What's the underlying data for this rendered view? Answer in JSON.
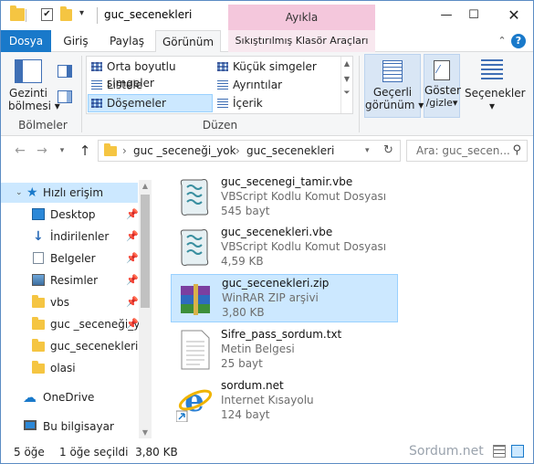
{
  "window": {
    "title": "guc_secenekleri",
    "context_tab": "Ayıkla",
    "accent": "#1979ca",
    "selection_color": "#cce8ff"
  },
  "quick_access_icons": [
    "folder-icon",
    "checkmark-icon",
    "folder-icon",
    "dropdown-arrow-icon"
  ],
  "ribbon": {
    "tabs": [
      {
        "label": "Dosya"
      },
      {
        "label": "Giriş"
      },
      {
        "label": "Paylaş"
      },
      {
        "label": "Görünüm"
      },
      {
        "label": "Sıkıştırılmış Klasör Araçları"
      }
    ],
    "panes": {
      "nav_pane_line1": "Gezinti",
      "nav_pane_line2": "bölmesi",
      "group_label": "Bölmeler"
    },
    "layout": {
      "items": [
        {
          "label": "Orta boyutlu simgeler"
        },
        {
          "label": "Küçük simgeler"
        },
        {
          "label": "Listele"
        },
        {
          "label": "Ayrıntılar"
        },
        {
          "label": "Döşemeler"
        },
        {
          "label": "İçerik"
        }
      ],
      "selected": "Döşemeler",
      "group_label": "Düzen"
    },
    "current_view": {
      "line1": "Geçerli",
      "line2": "görünüm"
    },
    "show_hide": {
      "line1": "Göster",
      "line2": "/gizle"
    },
    "options": {
      "label": "Seçenekler"
    }
  },
  "address": {
    "crumbs": [
      "guc _seceneği_yok",
      "guc_secenekleri"
    ],
    "search_placeholder": "Ara: guc_secen..."
  },
  "nav_pane": {
    "items": [
      {
        "label": "Hızlı erişim",
        "icon": "star-icon",
        "pinned": false
      },
      {
        "label": "Desktop",
        "icon": "desktop-icon",
        "pinned": true
      },
      {
        "label": "İndirilenler",
        "icon": "download-icon",
        "pinned": true
      },
      {
        "label": "Belgeler",
        "icon": "documents-icon",
        "pinned": true
      },
      {
        "label": "Resimler",
        "icon": "pictures-icon",
        "pinned": true
      },
      {
        "label": "vbs",
        "icon": "folder-icon",
        "pinned": true
      },
      {
        "label": "guc _seceneği_y",
        "icon": "folder-icon",
        "pinned": true
      },
      {
        "label": "guc_secenekleri",
        "icon": "folder-icon",
        "pinned": false
      },
      {
        "label": "olasi",
        "icon": "folder-icon",
        "pinned": false
      },
      {
        "label": "OneDrive",
        "icon": "cloud-icon",
        "pinned": false
      },
      {
        "label": "Bu bilgisayar",
        "icon": "computer-icon",
        "pinned": false
      }
    ]
  },
  "files": [
    {
      "name": "guc_secenegi_tamir.vbe",
      "type": "VBScript Kodlu Komut Dosyası",
      "size": "545 bayt",
      "icon": "vbscript-icon",
      "selected": false
    },
    {
      "name": "guc_secenekleri.vbe",
      "type": "VBScript Kodlu Komut Dosyası",
      "size": "4,59 KB",
      "icon": "vbscript-icon",
      "selected": false
    },
    {
      "name": "guc_secenekleri.zip",
      "type": "WinRAR ZIP arşivi",
      "size": "3,80 KB",
      "icon": "winrar-icon",
      "selected": true
    },
    {
      "name": "Sifre_pass_sordum.txt",
      "type": "Metin Belgesi",
      "size": "25 bayt",
      "icon": "text-document-icon",
      "selected": false
    },
    {
      "name": "sordum.net",
      "type": "Internet Kısayolu",
      "size": "124 bayt",
      "icon": "internet-explorer-icon",
      "selected": false
    }
  ],
  "status": {
    "count": "5 öğe",
    "selection": "1 öğe seçildi  3,80 KB"
  },
  "watermark": "Sordum.net"
}
